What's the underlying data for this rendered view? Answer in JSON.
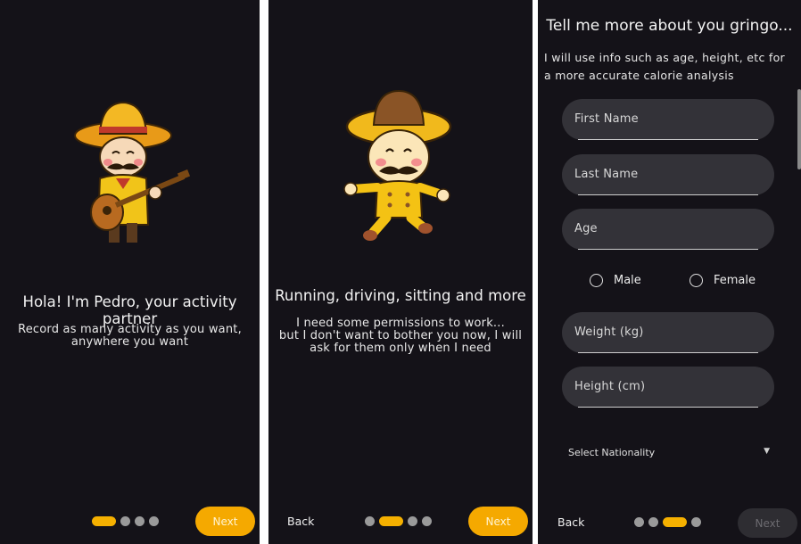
{
  "screen1": {
    "title": "Hola! I'm Pedro, your activity partner",
    "body": "Record as many activity as you want,\nanywhere you want",
    "next_label": "Next"
  },
  "screen2": {
    "title": "Running, driving, sitting and more",
    "body": "I need some permissions to work...\nbut I don't want to bother you now, I will\nask for them only when I need",
    "back_label": "Back",
    "next_label": "Next"
  },
  "screen3": {
    "title": "Tell me more about you gringo...",
    "description": "I will use info such as age, height, etc for a more accurate calorie analysis",
    "fields": {
      "first_name": "First Name",
      "last_name": "Last Name",
      "age": "Age",
      "weight": "Weight (kg)",
      "height": "Height (cm)"
    },
    "gender_options": [
      "Male",
      "Female"
    ],
    "nationality_placeholder": "Select Nationality",
    "back_label": "Back",
    "next_label": "Next"
  },
  "colors": {
    "background": "#141218",
    "accent": "#f5b000",
    "field": "#333238"
  }
}
